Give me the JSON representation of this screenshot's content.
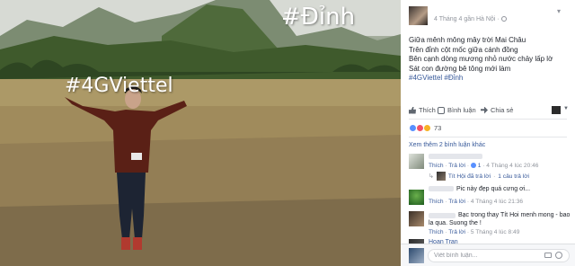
{
  "photo": {
    "hashtag_top": "#Đỉnh",
    "hashtag_left": "#4GViettel"
  },
  "post": {
    "meta": "4 Tháng 4 gần Hà Nội ·",
    "lines": [
      "Giữa mênh mông mây trời Mai Châu",
      "Trên đỉnh cột mốc giữa cánh đồng",
      "Bên cạnh dòng mương nhỏ nước chảy lấp lờ",
      "Sát con đường bê tông mới làm"
    ],
    "hashtags": "#4GViettel #Đỉnh"
  },
  "actions": {
    "like": "Thích",
    "comment": "Bình luận",
    "share": "Chia sẻ"
  },
  "reactions": {
    "count": "73"
  },
  "comments": {
    "more": "Xem thêm 2 bình luận khác",
    "c1": {
      "like": "Thích",
      "reply": "Trả lời",
      "likes": "1",
      "time": "4 Tháng 4 lúc 20:46",
      "reply_author": "Tít Hội đã trả lời",
      "reply_count": "1 câu trả lời"
    },
    "c2": {
      "text": "Pic này đẹp quá cưng ơi...",
      "like": "Thích",
      "reply": "Trả lời",
      "time": "4 Tháng 4 lúc 21:36"
    },
    "c3": {
      "text1": "Bạc trong thay Tít Hoi menh mong - bao",
      "text2": "la qua. Suong the !",
      "like": "Thích",
      "reply": "Trả lời",
      "time": "5 Tháng 4 lúc 8:49"
    },
    "c4": {
      "text": "Hoan Tran"
    }
  },
  "composer": {
    "placeholder": "Viết bình luận..."
  },
  "colors": {
    "link": "#365899",
    "meta": "#90949c",
    "like": "#5890ff",
    "love": "#f25268",
    "wow": "#f7b125"
  }
}
